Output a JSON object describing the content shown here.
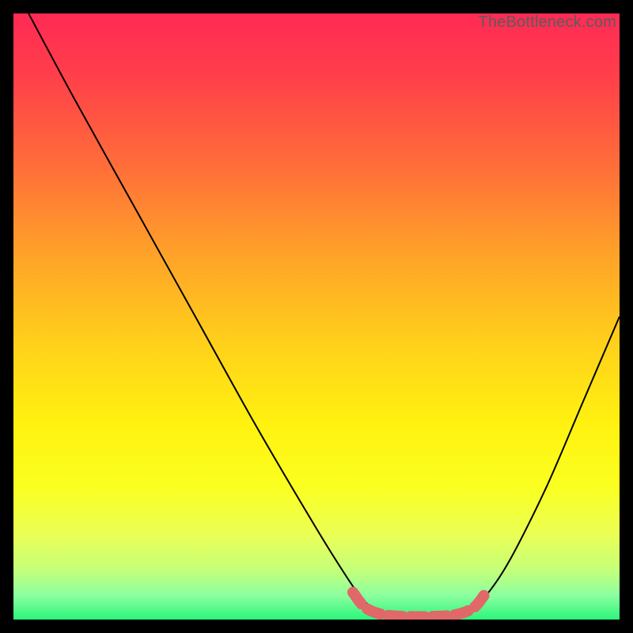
{
  "watermark": "TheBottleneck.com",
  "chart_data": {
    "type": "line",
    "title": "",
    "xlabel": "",
    "ylabel": "",
    "xlim": [
      0,
      100
    ],
    "ylim": [
      0,
      100
    ],
    "background_gradient_stops": [
      {
        "offset": 0.0,
        "color": "#ff2a55"
      },
      {
        "offset": 0.1,
        "color": "#ff3e4a"
      },
      {
        "offset": 0.25,
        "color": "#ff6d3a"
      },
      {
        "offset": 0.4,
        "color": "#ffa328"
      },
      {
        "offset": 0.55,
        "color": "#ffd21a"
      },
      {
        "offset": 0.68,
        "color": "#fff210"
      },
      {
        "offset": 0.78,
        "color": "#fbff20"
      },
      {
        "offset": 0.86,
        "color": "#eaff55"
      },
      {
        "offset": 0.92,
        "color": "#c3ff7a"
      },
      {
        "offset": 0.96,
        "color": "#8cffa0"
      },
      {
        "offset": 1.0,
        "color": "#2cf57a"
      }
    ],
    "series": [
      {
        "name": "bottleneck-curve",
        "style": "line",
        "color": "#000000",
        "points": [
          {
            "x": 2.5,
            "y": 100.0
          },
          {
            "x": 10.0,
            "y": 86.0
          },
          {
            "x": 20.0,
            "y": 68.0
          },
          {
            "x": 30.0,
            "y": 50.0
          },
          {
            "x": 40.0,
            "y": 32.0
          },
          {
            "x": 50.0,
            "y": 15.0
          },
          {
            "x": 55.0,
            "y": 7.0
          },
          {
            "x": 57.5,
            "y": 3.5
          },
          {
            "x": 60.0,
            "y": 1.5
          },
          {
            "x": 65.0,
            "y": 0.5
          },
          {
            "x": 70.0,
            "y": 0.5
          },
          {
            "x": 75.0,
            "y": 1.5
          },
          {
            "x": 78.0,
            "y": 4.0
          },
          {
            "x": 82.0,
            "y": 10.0
          },
          {
            "x": 88.0,
            "y": 22.0
          },
          {
            "x": 94.0,
            "y": 36.0
          },
          {
            "x": 100.0,
            "y": 50.0
          }
        ]
      },
      {
        "name": "highlight-band",
        "style": "thick-line",
        "color": "#e06868",
        "points": [
          {
            "x": 56.0,
            "y": 4.5
          },
          {
            "x": 58.0,
            "y": 2.0
          },
          {
            "x": 61.0,
            "y": 0.8
          },
          {
            "x": 65.0,
            "y": 0.5
          },
          {
            "x": 69.0,
            "y": 0.5
          },
          {
            "x": 73.0,
            "y": 0.8
          },
          {
            "x": 76.0,
            "y": 2.0
          },
          {
            "x": 78.0,
            "y": 4.5
          }
        ]
      }
    ]
  }
}
